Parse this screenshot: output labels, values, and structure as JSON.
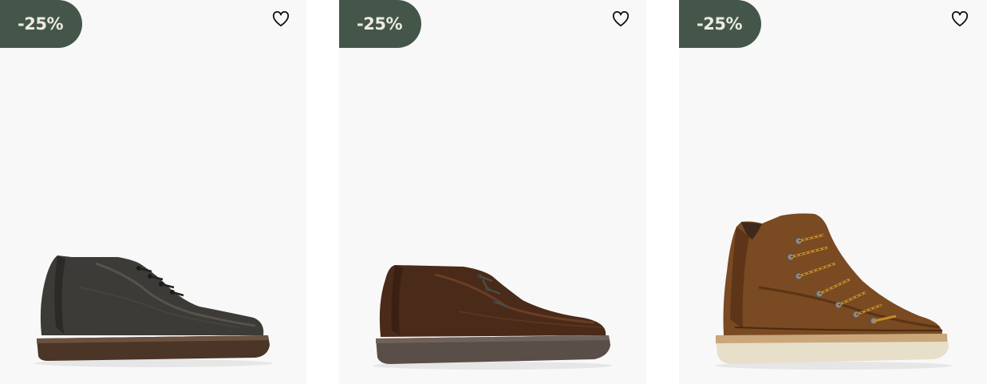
{
  "products": [
    {
      "discount": "-25%",
      "image": "dark-grey-suede-chukka-boot",
      "favorite_icon": "heart-outline-icon"
    },
    {
      "discount": "-25%",
      "image": "brown-suede-moccasin-chukka-boot",
      "favorite_icon": "heart-outline-icon"
    },
    {
      "discount": "-25%",
      "image": "brown-leather-hiking-boot",
      "favorite_icon": "heart-outline-icon"
    }
  ],
  "colors": {
    "card_background": "#f8f8f8",
    "badge_background": "#44564a",
    "badge_text": "#efeae0"
  }
}
